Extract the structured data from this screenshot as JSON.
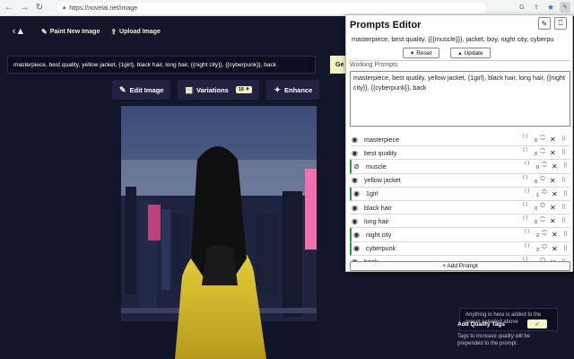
{
  "browser": {
    "url": "https://novelai.net/image",
    "lock_icon": "lock-icon"
  },
  "header": {
    "paint_label": "Paint New Image",
    "upload_label": "Upload Image"
  },
  "prompt_input": {
    "value": "masterpiece, best quality, yellow jacket, {1girl}, black hair, long hair, {{night city}}, {{cyberpunk}}, back"
  },
  "generate_button": {
    "label": "Ge"
  },
  "toolbar": {
    "edit_label": "Edit Image",
    "variations_label": "Variations",
    "variations_badge": "18 ⚘",
    "enhance_label": "Enhance"
  },
  "side": {
    "preset_note": "Anything in here is added to the preset selected above",
    "quality_title": "Add Quality Tags",
    "quality_desc": "Tags to increase quality will be prepended to the prompt.",
    "toggle_mark": "✓"
  },
  "panel": {
    "title": "Prompts Editor",
    "prompt_preview": "masterpiece, best quality, {{{muscle}}}, jacket, boy, night city, cyberpu",
    "reset_label": "Reset",
    "update_label": "Update",
    "working_label": "Working Prompts",
    "working_text": "masterpiece, best quality, yellow jacket, {1girl}, black hair, long hair, {{night city}}, {{cyberpunk}}, back",
    "add_label": "+ Add Prompt",
    "tags": [
      {
        "label": "masterpiece",
        "count": "0",
        "braces": "{ }",
        "hidden": false,
        "green": false
      },
      {
        "label": "best quality",
        "count": "0",
        "braces": "{ }",
        "hidden": false,
        "green": false
      },
      {
        "label": "muscle",
        "count": "0",
        "braces": "{ }",
        "hidden": true,
        "green": true
      },
      {
        "label": "yellow jacket",
        "count": "0",
        "braces": "{ }",
        "hidden": false,
        "green": false
      },
      {
        "label": "1girl",
        "count": "1",
        "braces": "{ }",
        "hidden": false,
        "green": true
      },
      {
        "label": "black hair",
        "count": "0",
        "braces": "{ }",
        "hidden": false,
        "green": false
      },
      {
        "label": "long hair",
        "count": "0",
        "braces": "{ }",
        "hidden": false,
        "green": false
      },
      {
        "label": "night city",
        "count": "2",
        "braces": "{ }",
        "hidden": false,
        "green": true
      },
      {
        "label": "cyberpunk",
        "count": "2",
        "braces": "{ }",
        "hidden": false,
        "green": true
      },
      {
        "label": "back",
        "count": "0",
        "braces": "{ }",
        "hidden": false,
        "green": false
      }
    ]
  },
  "colors": {
    "bg": "#13152b",
    "accent": "#f5f3c2",
    "green": "#2e9c4a"
  }
}
